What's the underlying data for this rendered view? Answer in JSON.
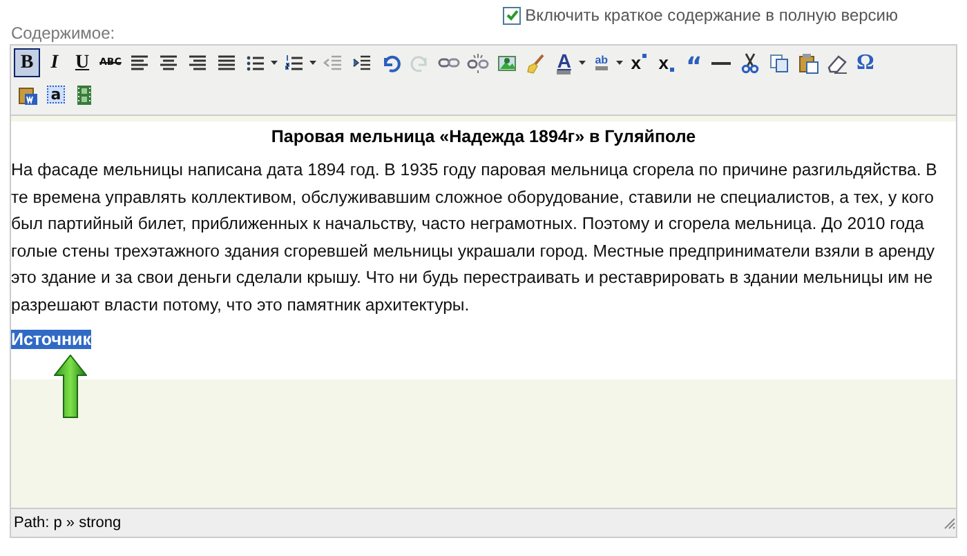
{
  "field_label": "Содержимое:",
  "summary_option": {
    "label": "Включить краткое содержание в полную версию",
    "checked": true
  },
  "toolbar": {
    "rows": [
      [
        {
          "kind": "bold",
          "glyph": "B",
          "selected": true,
          "disabled": false
        },
        {
          "kind": "italic",
          "glyph": "I",
          "selected": false,
          "disabled": false
        },
        {
          "kind": "underline",
          "glyph": "U",
          "selected": false,
          "disabled": false
        },
        {
          "kind": "strike",
          "glyph": "ABC",
          "selected": false,
          "disabled": false
        },
        {
          "kind": "align-left",
          "selected": false,
          "disabled": false
        },
        {
          "kind": "align-center",
          "selected": false,
          "disabled": false
        },
        {
          "kind": "align-right",
          "selected": false,
          "disabled": false
        },
        {
          "kind": "justify",
          "selected": false,
          "disabled": false
        },
        {
          "kind": "bullets",
          "dropdown": true,
          "selected": false,
          "disabled": false
        },
        {
          "kind": "numbers",
          "dropdown": true,
          "selected": false,
          "disabled": false
        },
        {
          "kind": "outdent",
          "selected": false,
          "disabled": true
        },
        {
          "kind": "indent",
          "selected": false,
          "disabled": false
        },
        {
          "kind": "undo",
          "selected": false,
          "disabled": false
        },
        {
          "kind": "redo",
          "selected": false,
          "disabled": true
        },
        {
          "kind": "link",
          "selected": false,
          "disabled": false
        },
        {
          "kind": "unlink",
          "selected": false,
          "disabled": false
        },
        {
          "kind": "image",
          "selected": false,
          "disabled": false
        },
        {
          "kind": "cleanup",
          "selected": false,
          "disabled": false
        },
        {
          "kind": "text-color",
          "glyph": "A",
          "dropdown": true,
          "selected": false,
          "disabled": false
        },
        {
          "kind": "highlight",
          "glyph": "ab",
          "dropdown": true,
          "selected": false,
          "disabled": false
        },
        {
          "kind": "sup",
          "glyph": "x",
          "selected": false,
          "disabled": false
        },
        {
          "kind": "sub",
          "glyph": "x",
          "selected": false,
          "disabled": false
        },
        {
          "kind": "quote",
          "glyph": "“",
          "selected": false,
          "disabled": false
        },
        {
          "kind": "hr",
          "selected": false,
          "disabled": false
        },
        {
          "kind": "cut",
          "selected": false,
          "disabled": false
        },
        {
          "kind": "copy",
          "selected": false,
          "disabled": false
        },
        {
          "kind": "paste",
          "selected": false,
          "disabled": false
        },
        {
          "kind": "eraser",
          "selected": false,
          "disabled": false
        },
        {
          "kind": "charmap",
          "glyph": "Ω",
          "selected": false,
          "disabled": false
        }
      ],
      [
        {
          "kind": "paste-word",
          "selected": false,
          "disabled": false
        },
        {
          "kind": "paste-text",
          "glyph": "a",
          "selected": false,
          "disabled": false
        },
        {
          "kind": "media",
          "selected": false,
          "disabled": false
        }
      ]
    ]
  },
  "content": {
    "heading": "Паровая мельница «Надежда 1894г» в Гуляйполе",
    "paragraph": "На фасаде мельницы написана дата 1894 год. В 1935 году паровая мельница сгорела по причине разгильдяйства. В те времена управлять коллективом, обслуживавшим сложное оборудование, ставили не специалистов, а тех, у кого был партийный билет, приближенных к начальству, часто неграмотных. Поэтому и сгорела мельница. До 2010 года голые стены трехэтажного здания сгоревшей мельницы украшали город. Местные предприниматели взяли в аренду это здание и за свои деньги сделали крышу. Что ни будь перестраивать и реставрировать в здании мельницы им не разрешают власти потому, что это памятник архитектуры.",
    "source": {
      "text": "Источник",
      "selected": true
    }
  },
  "status_bar": {
    "path": "Path: p » strong"
  }
}
